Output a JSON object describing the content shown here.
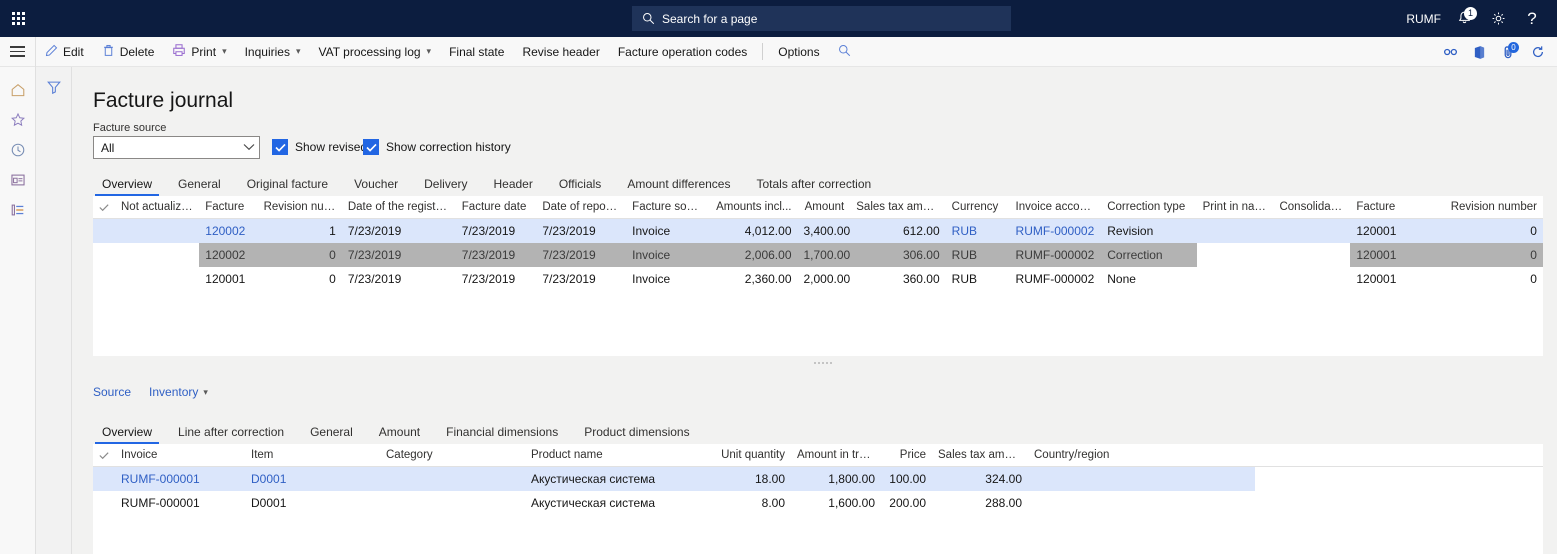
{
  "topbar": {
    "waffle_icon": "app-launcher-icon",
    "search": {
      "icon": "search-icon",
      "placeholder": "Search for a page",
      "value": ""
    },
    "company": "RUMF",
    "notifications_icon": "bell-icon",
    "notifications_count": "1",
    "settings_icon": "gear-icon",
    "help_icon": "help-icon"
  },
  "commandbar": {
    "menu_icon": "hamburger-icon",
    "items": [
      {
        "label": "Edit",
        "icon": "pencil-icon",
        "has_chevron": false
      },
      {
        "label": "Delete",
        "icon": "trash-icon",
        "has_chevron": false
      },
      {
        "label": "Print",
        "icon": "printer-icon",
        "has_chevron": true
      },
      {
        "label": "Inquiries",
        "icon": "",
        "has_chevron": true
      },
      {
        "label": "VAT processing log",
        "icon": "",
        "has_chevron": true
      },
      {
        "label": "Final state",
        "icon": "",
        "has_chevron": false
      },
      {
        "label": "Revise header",
        "icon": "",
        "has_chevron": false
      },
      {
        "label": "Facture operation codes",
        "icon": "",
        "has_chevron": false
      },
      {
        "label": "Options",
        "icon": "",
        "has_chevron": false
      }
    ],
    "search_icon": "search-icon",
    "right_icons": [
      {
        "name": "link-icon",
        "badge": ""
      },
      {
        "name": "office-icon",
        "badge": ""
      },
      {
        "name": "attachment-icon",
        "badge": "0"
      },
      {
        "name": "refresh-icon",
        "badge": ""
      }
    ]
  },
  "rail": {
    "items": [
      {
        "name": "home-icon",
        "label": "Home"
      },
      {
        "name": "star-icon",
        "label": "Favorites"
      },
      {
        "name": "clock-icon",
        "label": "Recent"
      },
      {
        "name": "workspace-icon",
        "label": "Workspaces"
      },
      {
        "name": "modules-icon",
        "label": "Modules"
      }
    ],
    "filter_icon": "filter-icon"
  },
  "page": {
    "title": "Facture journal",
    "facture_source": {
      "label": "Facture source",
      "value": "All"
    },
    "checkboxes": [
      {
        "label": "Show revised",
        "checked": true
      },
      {
        "label": "Show correction history",
        "checked": true
      }
    ]
  },
  "header_tabs": {
    "active": "Overview",
    "items": [
      "Overview",
      "General",
      "Original facture",
      "Voucher",
      "Delivery",
      "Header",
      "Officials",
      "Amount differences",
      "Totals after correction"
    ]
  },
  "header_grid": {
    "columns": [
      "Not actualized",
      "Facture",
      "Revision number",
      "Date of the registration",
      "Facture date",
      "Date of reporting",
      "Facture source",
      "Amounts incl...",
      "Amount",
      "Sales tax amount",
      "Currency",
      "Invoice account",
      "Correction type",
      "Print in nationa...",
      "Consolidated",
      "Facture",
      "Revision number"
    ],
    "sort_column": "Date of the registration",
    "sort_arrow": "↓",
    "rows": [
      {
        "state": "selected",
        "not_actualized": "",
        "facture": "120002",
        "revision_number": "1",
        "date_of_registration": "7/23/2019",
        "facture_date": "7/23/2019",
        "date_of_reporting": "7/23/2019",
        "facture_source": "Invoice",
        "amounts_incl": "4,012.00",
        "amount": "3,400.00",
        "sales_tax_amount": "612.00",
        "currency": "RUB",
        "invoice_account": "RUMF-000002",
        "correction_type": "Revision",
        "print_in_national": "",
        "consolidated": "",
        "facture2": "120001",
        "revision_number2": "0"
      },
      {
        "state": "highlighted",
        "not_actualized": "",
        "facture": "120002",
        "revision_number": "0",
        "date_of_registration": "7/23/2019",
        "facture_date": "7/23/2019",
        "date_of_reporting": "7/23/2019",
        "facture_source": "Invoice",
        "amounts_incl": "2,006.00",
        "amount": "1,700.00",
        "sales_tax_amount": "306.00",
        "currency": "RUB",
        "invoice_account": "RUMF-000002",
        "correction_type": "Correction",
        "print_in_national": "",
        "consolidated": "",
        "facture2": "120001",
        "revision_number2": "0"
      },
      {
        "state": "normal",
        "not_actualized": "",
        "facture": "120001",
        "revision_number": "0",
        "date_of_registration": "7/23/2019",
        "facture_date": "7/23/2019",
        "date_of_reporting": "7/23/2019",
        "facture_source": "Invoice",
        "amounts_incl": "2,360.00",
        "amount": "2,000.00",
        "sales_tax_amount": "360.00",
        "currency": "RUB",
        "invoice_account": "RUMF-000002",
        "correction_type": "None",
        "print_in_national": "",
        "consolidated": "",
        "facture2": "120001",
        "revision_number2": "0"
      }
    ]
  },
  "lines_toolbar": {
    "items": [
      {
        "label": "Source",
        "has_chevron": false
      },
      {
        "label": "Inventory",
        "has_chevron": true
      }
    ]
  },
  "lines_tabs": {
    "active": "Overview",
    "items": [
      "Overview",
      "Line after correction",
      "General",
      "Amount",
      "Financial dimensions",
      "Product dimensions"
    ]
  },
  "lines_grid": {
    "columns": [
      "Invoice",
      "Item",
      "Category",
      "Product name",
      "Unit quantity",
      "Amount in tran...",
      "Price",
      "Sales tax amount",
      "Country/region"
    ],
    "rows": [
      {
        "state": "selected",
        "invoice": "RUMF-000001",
        "item": "D0001",
        "category": "",
        "product_name": "Акустическая система",
        "unit_quantity": "18.00",
        "amount_in_tran": "1,800.00",
        "price": "100.00",
        "sales_tax_amount": "324.00",
        "country_region": ""
      },
      {
        "state": "normal",
        "invoice": "RUMF-000001",
        "item": "D0001",
        "category": "",
        "product_name": "Акустическая система",
        "unit_quantity": "8.00",
        "amount_in_tran": "1,600.00",
        "price": "200.00",
        "sales_tax_amount": "288.00",
        "country_region": ""
      }
    ]
  },
  "colors": {
    "topbar_bg": "#0c1d3f",
    "accent": "#2266e3",
    "selected_row": "#dbe6fb",
    "highlight_cell": "#b3b3b3",
    "link": "#2f5fc4"
  }
}
